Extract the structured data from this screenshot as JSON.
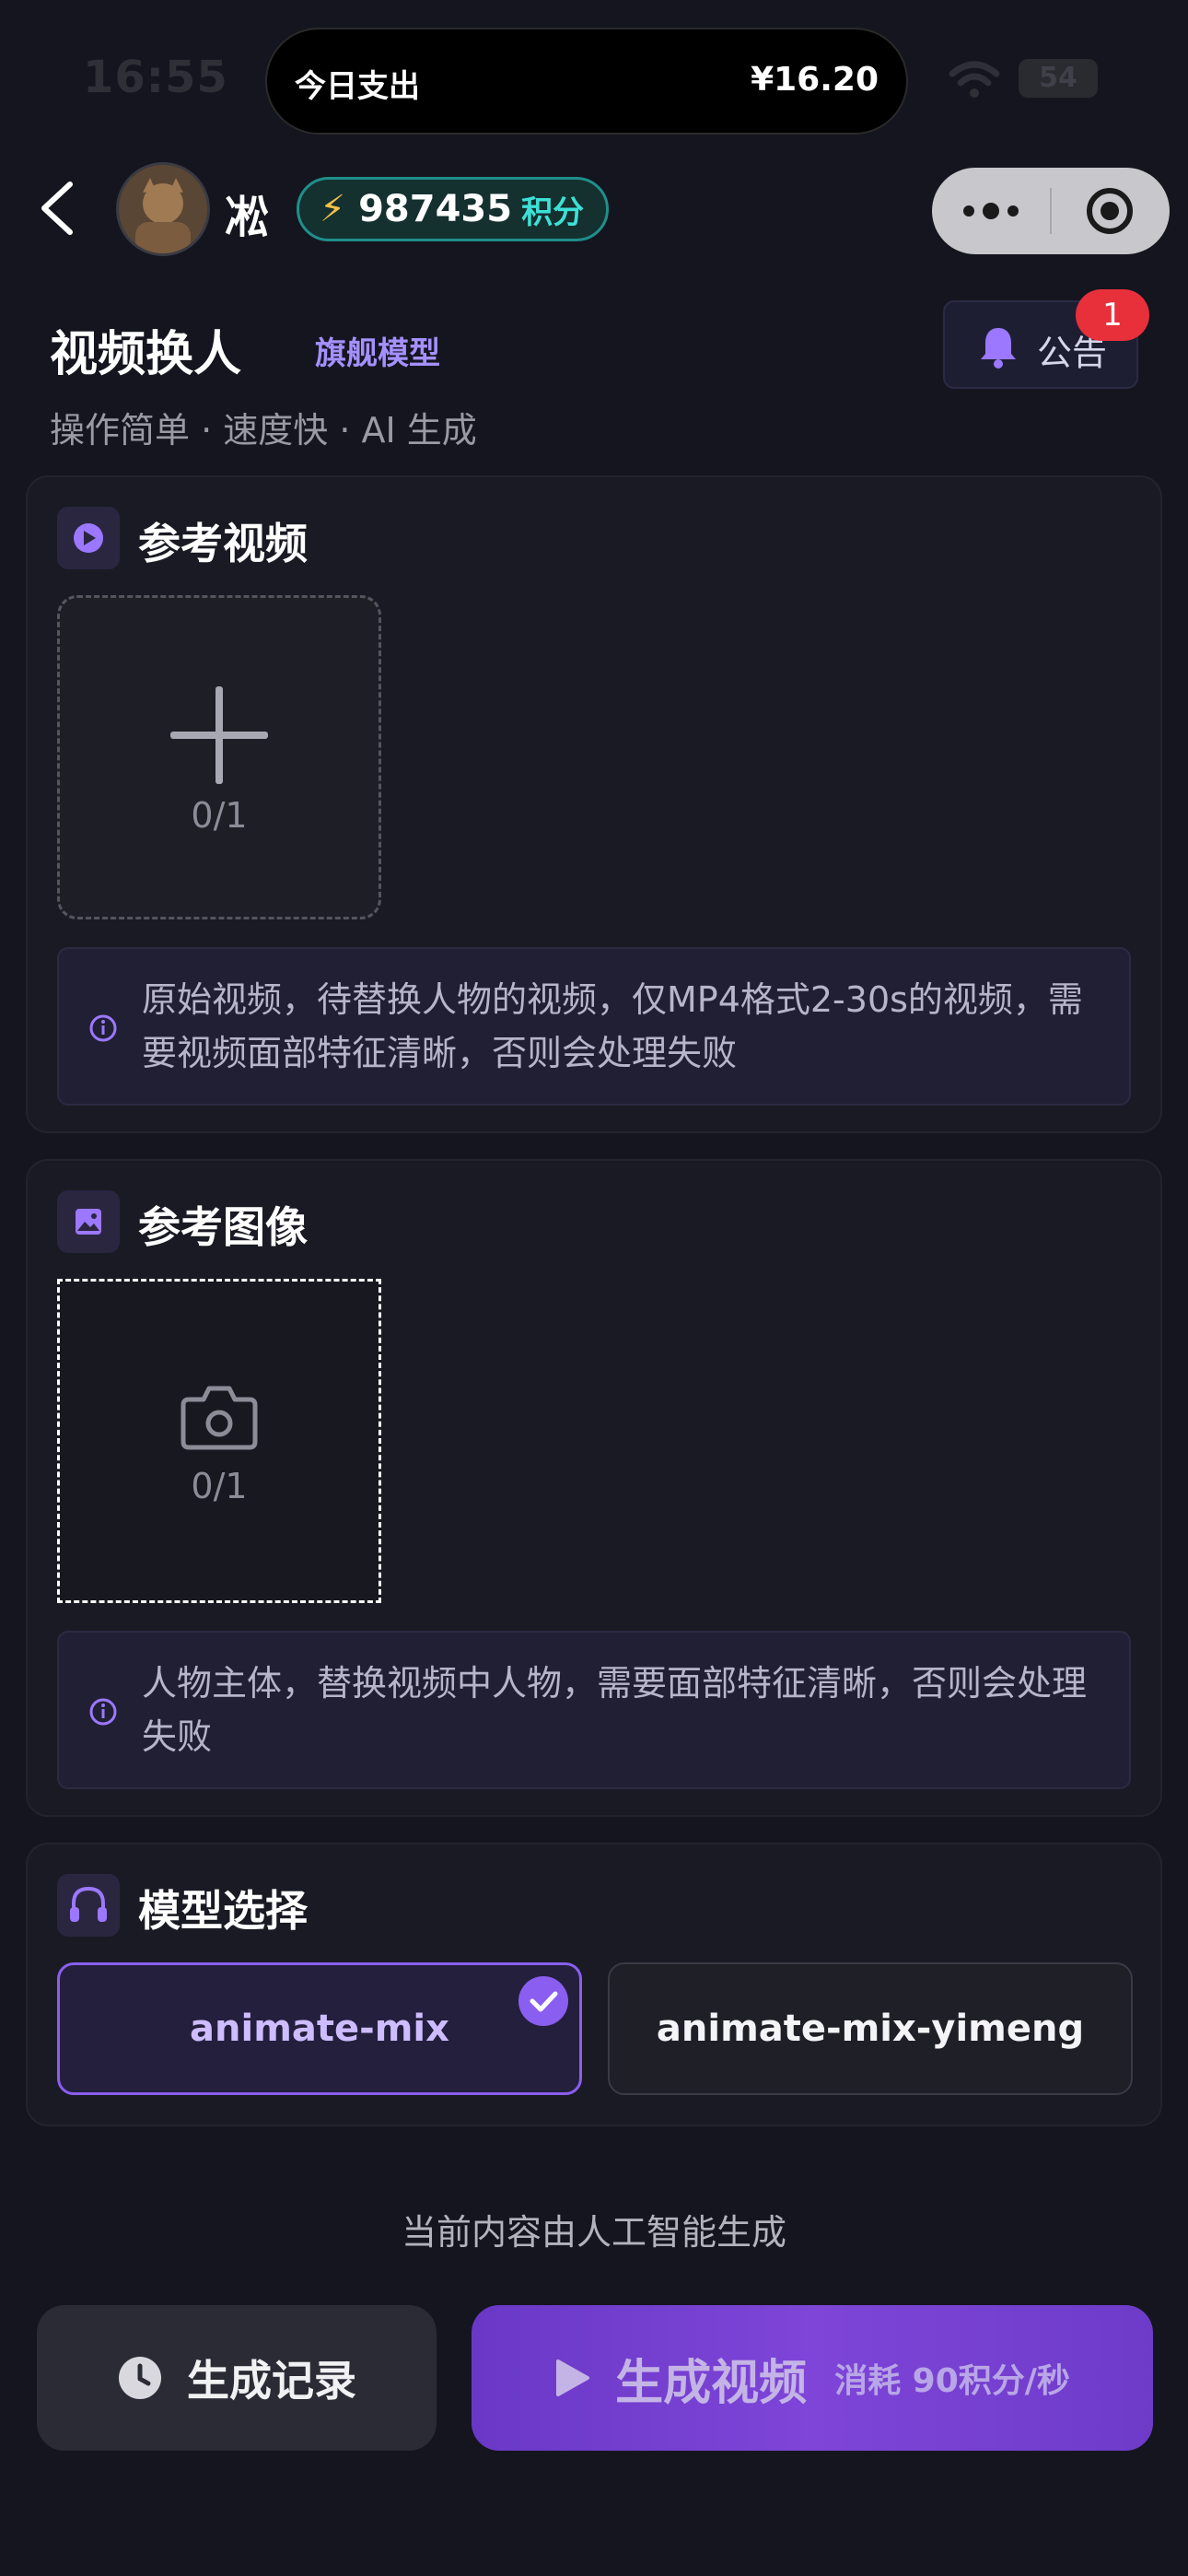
{
  "status_bar": {
    "time": "16:55",
    "island_label": "今日支出",
    "island_amount": "¥16.20",
    "battery": "54"
  },
  "nav": {
    "username": "凇",
    "points_value": "987435",
    "points_unit": "积分"
  },
  "header": {
    "title": "视频换人",
    "flagship_label": "旗舰模型",
    "subtitle": "操作简单 · 速度快 · AI 生成",
    "notice_label": "公告",
    "notice_count": "1"
  },
  "reference_video": {
    "title": "参考视频",
    "count": "0/1",
    "hint": "原始视频，待替换人物的视频，仅MP4格式2-30s的视频，需要视频面部特征清晰，否则会处理失败"
  },
  "reference_image": {
    "title": "参考图像",
    "count": "0/1",
    "hint": "人物主体，替换视频中人物，需要面部特征清晰，否则会处理失败"
  },
  "model_select": {
    "title": "模型选择",
    "options": [
      {
        "label": "animate-mix",
        "selected": true
      },
      {
        "label": "animate-mix-yimeng",
        "selected": false
      }
    ]
  },
  "footer": {
    "disclaimer": "当前内容由人工智能生成",
    "history_label": "生成记录",
    "generate_label": "生成视频",
    "generate_cost": "消耗 90积分/秒"
  },
  "colors": {
    "background": "#15151f",
    "accent_purple": "#8a5ef0",
    "points_teal": "#3de0d6",
    "badge_red": "#e8303a"
  },
  "icons": [
    "back-icon",
    "lightning-icon",
    "more-icon",
    "close-target-icon",
    "bell-icon",
    "play-icon",
    "plus-icon",
    "info-icon",
    "image-icon",
    "camera-icon",
    "headset-icon",
    "check-icon",
    "clock-icon"
  ]
}
